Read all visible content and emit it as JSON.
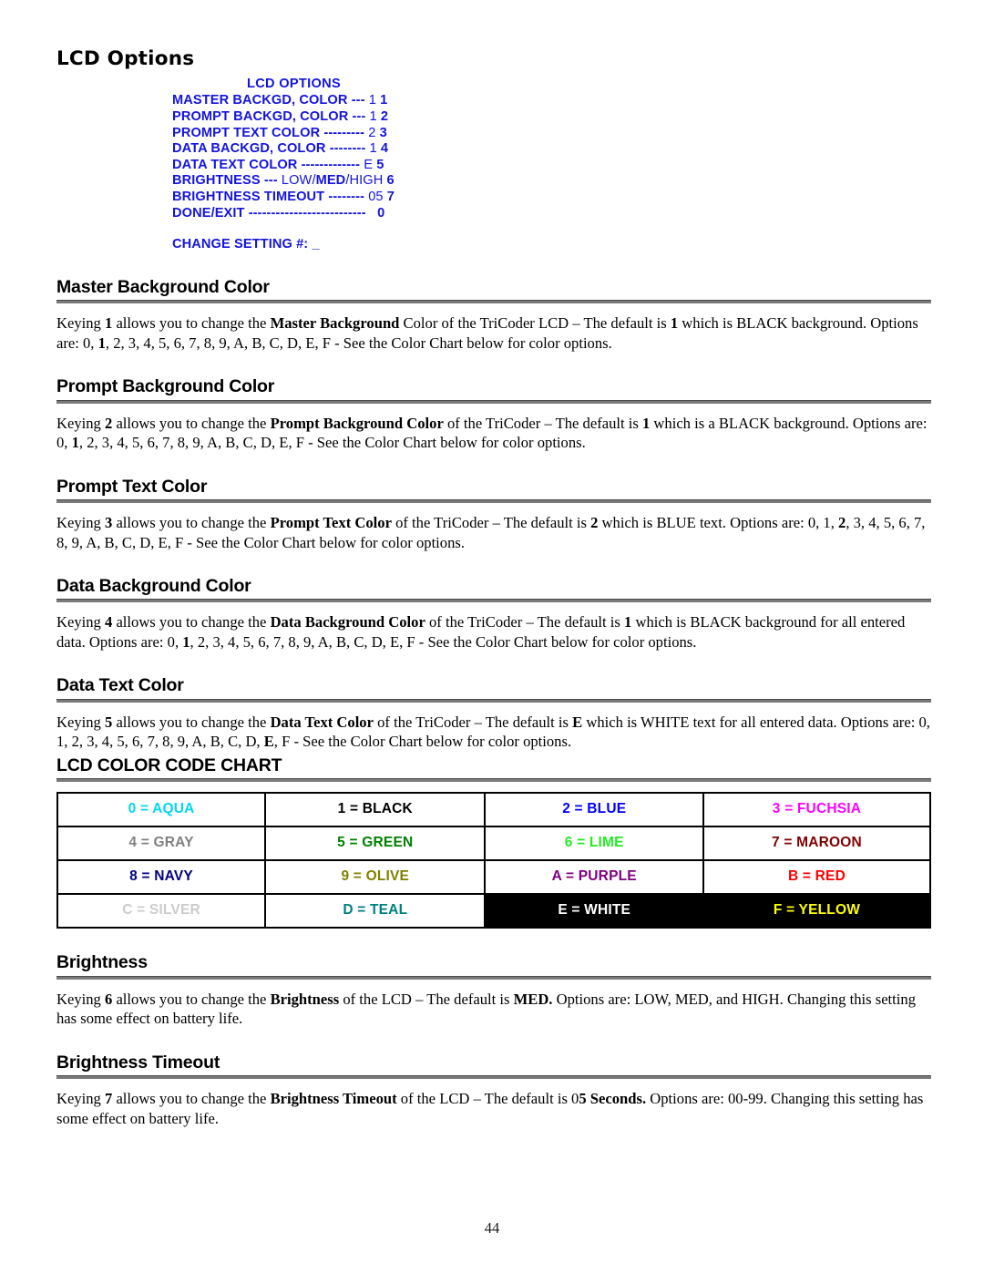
{
  "document": {
    "title": "LCD Options",
    "page_number": "44"
  },
  "lcd_screen": {
    "title": "LCD OPTIONS",
    "text_color": "#1414e0",
    "lines": [
      {
        "label": "MASTER BACKGD, COLOR",
        "dashes": "---",
        "value": "1",
        "key": "1"
      },
      {
        "label": "PROMPT BACKGD, COLOR",
        "dashes": "---",
        "value": "1",
        "key": "2"
      },
      {
        "label": "PROMPT TEXT  COLOR",
        "dashes": "---------",
        "value": "2",
        "key": "3"
      },
      {
        "label": "DATA BACKGD, COLOR",
        "dashes": "--------",
        "value": "1",
        "key": "4"
      },
      {
        "label": "DATA TEXT COLOR",
        "dashes": "-------------",
        "value": "E",
        "key": "5"
      },
      {
        "label": "BRIGHTNESS",
        "dashes": "---",
        "value_low": "LOW",
        "value_sep1": "/",
        "value_med": "MED",
        "value_sep2": "/",
        "value_high": "HIGH",
        "key": "6"
      },
      {
        "label": "BRIGHTNESS TIMEOUT",
        "dashes": "--------",
        "value": "05",
        "key": "7"
      },
      {
        "label": "DONE/EXIT",
        "dashes": "--------------------------",
        "value": "",
        "key": "0"
      }
    ],
    "prompt": "CHANGE SETTING #:  _"
  },
  "sections": [
    {
      "heading": "Master Background Color",
      "body_html": "Keying <b>1</b> allows you to change the <b>Master Background</b> Color of the TriCoder LCD – The default is <b>1</b> which is BLACK background. Options are: 0, <b>1</b>, 2, 3, 4, 5, 6, 7, 8, 9, A, B, C, D, E, F - See the Color Chart below for color options."
    },
    {
      "heading": "Prompt Background Color",
      "body_html": "Keying <b>2</b> allows you to change the <b>Prompt Background Color</b> of the TriCoder – The default is <b>1</b> which is a BLACK background. Options are: 0, <b>1</b>, 2, 3, 4, 5, 6, 7, 8, 9, A, B, C, D, E, F - See the Color Chart below for color options."
    },
    {
      "heading": "Prompt Text Color",
      "body_html": "Keying <b>3</b> allows you to change the <b>Prompt Text Color</b> of the TriCoder – The default is <b>2</b> which is BLUE text.  Options are: 0, 1, <b>2</b>, 3, 4, 5, 6, 7, 8, 9, A, B, C, D, E, F - See the Color Chart below for color options."
    },
    {
      "heading": "Data Background Color",
      "body_html": "Keying <b>4</b> allows you to change the <b>Data Background Color</b> of the TriCoder – The default is <b>1</b> which is BLACK background for all entered data.  Options are: 0, <b>1</b>, 2, 3, 4, 5, 6, 7, 8, 9, A, B, C, D, E, F - See the Color Chart below for color options."
    },
    {
      "heading": "Data Text Color",
      "body_html": "Keying <b>5</b> allows you to change the <b>Data Text Color</b> of the TriCoder – The default is <b>E</b> which is WHITE text for all entered data. Options are: 0, 1, 2, 3, 4, 5, 6, 7, 8, 9, A, B, C, D, <b>E</b>, F - See the Color Chart below for color options."
    }
  ],
  "color_chart": {
    "heading": "LCD COLOR CODE CHART",
    "rows": [
      [
        {
          "label": "0 = AQUA",
          "color": "#00d8f0",
          "bg": "#ffffff"
        },
        {
          "label": "1 = BLACK",
          "color": "#000000",
          "bg": "#ffffff"
        },
        {
          "label": "2 = BLUE",
          "color": "#0000ff",
          "bg": "#ffffff"
        },
        {
          "label": "3 = FUCHSIA",
          "color": "#ff00ff",
          "bg": "#ffffff"
        }
      ],
      [
        {
          "label": "4 = GRAY",
          "color": "#808080",
          "bg": "#ffffff"
        },
        {
          "label": "5 = GREEN",
          "color": "#008000",
          "bg": "#ffffff"
        },
        {
          "label": "6 = LIME",
          "color": "#22ee22",
          "bg": "#ffffff"
        },
        {
          "label": "7 = MAROON",
          "color": "#800000",
          "bg": "#ffffff"
        }
      ],
      [
        {
          "label": "8 = NAVY",
          "color": "#000080",
          "bg": "#ffffff"
        },
        {
          "label": "9 = OLIVE",
          "color": "#808000",
          "bg": "#ffffff"
        },
        {
          "label": "A = PURPLE",
          "color": "#800080",
          "bg": "#ffffff"
        },
        {
          "label": "B = RED",
          "color": "#ff0000",
          "bg": "#ffffff"
        }
      ],
      [
        {
          "label": "C = SILVER",
          "color": "#cccccc",
          "bg": "#ffffff"
        },
        {
          "label": "D = TEAL",
          "color": "#008080",
          "bg": "#ffffff"
        },
        {
          "label": "E = WHITE",
          "color": "#ffffff",
          "bg": "#000000"
        },
        {
          "label": "F = YELLOW",
          "color": "#ffff00",
          "bg": "#000000"
        }
      ]
    ]
  },
  "sections_tail": [
    {
      "heading": "Brightness",
      "body_html": "Keying <b>6</b> allows you to change the <b>Brightness</b> of the LCD – The default is <b>MED.</b> Options are: LOW, MED, and HIGH. Changing this setting has some effect on battery life."
    },
    {
      "heading": "Brightness Timeout",
      "body_html": "Keying <b>7</b> allows you to change the <b>Brightness Timeout</b> of the LCD – The default is 0<b>5 Seconds.</b> Options are: 00-99. Changing this setting has some effect on battery life."
    }
  ]
}
